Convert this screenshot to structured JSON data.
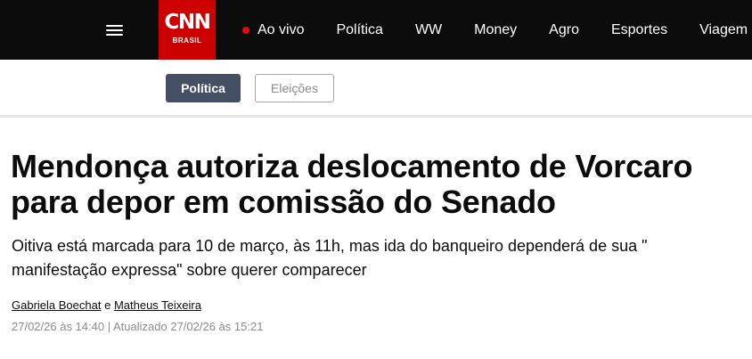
{
  "header": {
    "logo_main": "CNN",
    "logo_sub": "BRASIL",
    "nav": [
      {
        "label": "Ao vivo",
        "live": true
      },
      {
        "label": "Política"
      },
      {
        "label": "WW"
      },
      {
        "label": "Money"
      },
      {
        "label": "Agro"
      },
      {
        "label": "Esportes"
      },
      {
        "label": "Viagem"
      }
    ]
  },
  "tabs": [
    {
      "label": "Política",
      "active": true
    },
    {
      "label": "Eleições",
      "active": false
    }
  ],
  "article": {
    "headline": "Mendonça autoriza deslocamento de Vorcaro para depor em comissão do Senado",
    "subtitle": "Oitiva está marcada para 10 de março, às 11h, mas ida do banqueiro dependerá de sua \" manifestação expressa\" sobre querer comparecer",
    "authors": [
      "Gabriela Boechat",
      "Matheus Teixeira"
    ],
    "author_joiner": "e",
    "published": "27/02/26 às 14:40",
    "separator": "|",
    "updated": "Atualizado 27/02/26 às 15:21"
  },
  "colors": {
    "brand_red": "#cc0000",
    "nav_bg": "#0c0c0c",
    "active_tab": "#444f63",
    "live_dot": "#e50914"
  },
  "icons": [
    "hamburger-menu-icon",
    "live-dot-icon"
  ]
}
